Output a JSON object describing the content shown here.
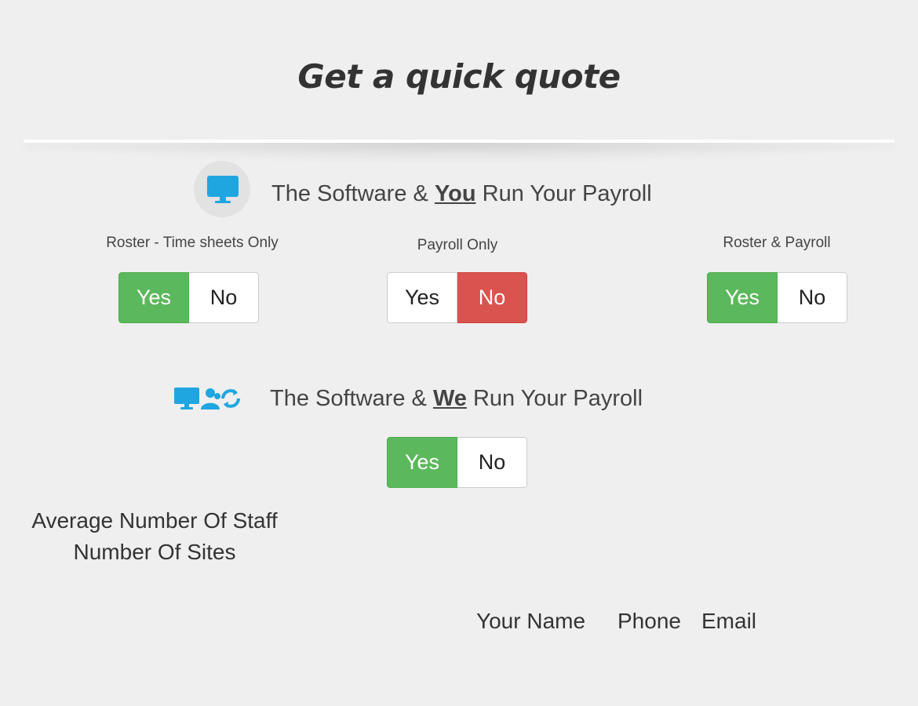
{
  "page": {
    "title": "Get a quick quote"
  },
  "sections": {
    "self_run": {
      "heading_prefix": "The Software & ",
      "heading_emphasis": "You",
      "heading_suffix": " Run Your Payroll",
      "icon": "monitor-icon",
      "options": [
        {
          "label": "Roster - Time sheets Only",
          "yes_label": "Yes",
          "no_label": "No",
          "selected": "yes"
        },
        {
          "label": "Payroll Only",
          "yes_label": "Yes",
          "no_label": "No",
          "selected": "no"
        },
        {
          "label": "Roster & Payroll",
          "yes_label": "Yes",
          "no_label": "No",
          "selected": "yes"
        }
      ]
    },
    "managed": {
      "heading_prefix": "The Software & ",
      "heading_emphasis": "We",
      "heading_suffix": " Run Your Payroll",
      "icons": [
        "monitor-icon",
        "people-icon",
        "refresh-icon"
      ],
      "option": {
        "yes_label": "Yes",
        "no_label": "No",
        "selected": "yes"
      }
    }
  },
  "fields": {
    "average_staff_label": "Average Number Of Staff",
    "sites_label": "Number Of Sites",
    "name_label": "Your Name",
    "phone_label": "Phone",
    "email_label": "Email"
  },
  "colors": {
    "accent_blue": "#1fa6e0",
    "yes_green": "#5cb85c",
    "no_red": "#d9534f",
    "background": "#efefef"
  }
}
